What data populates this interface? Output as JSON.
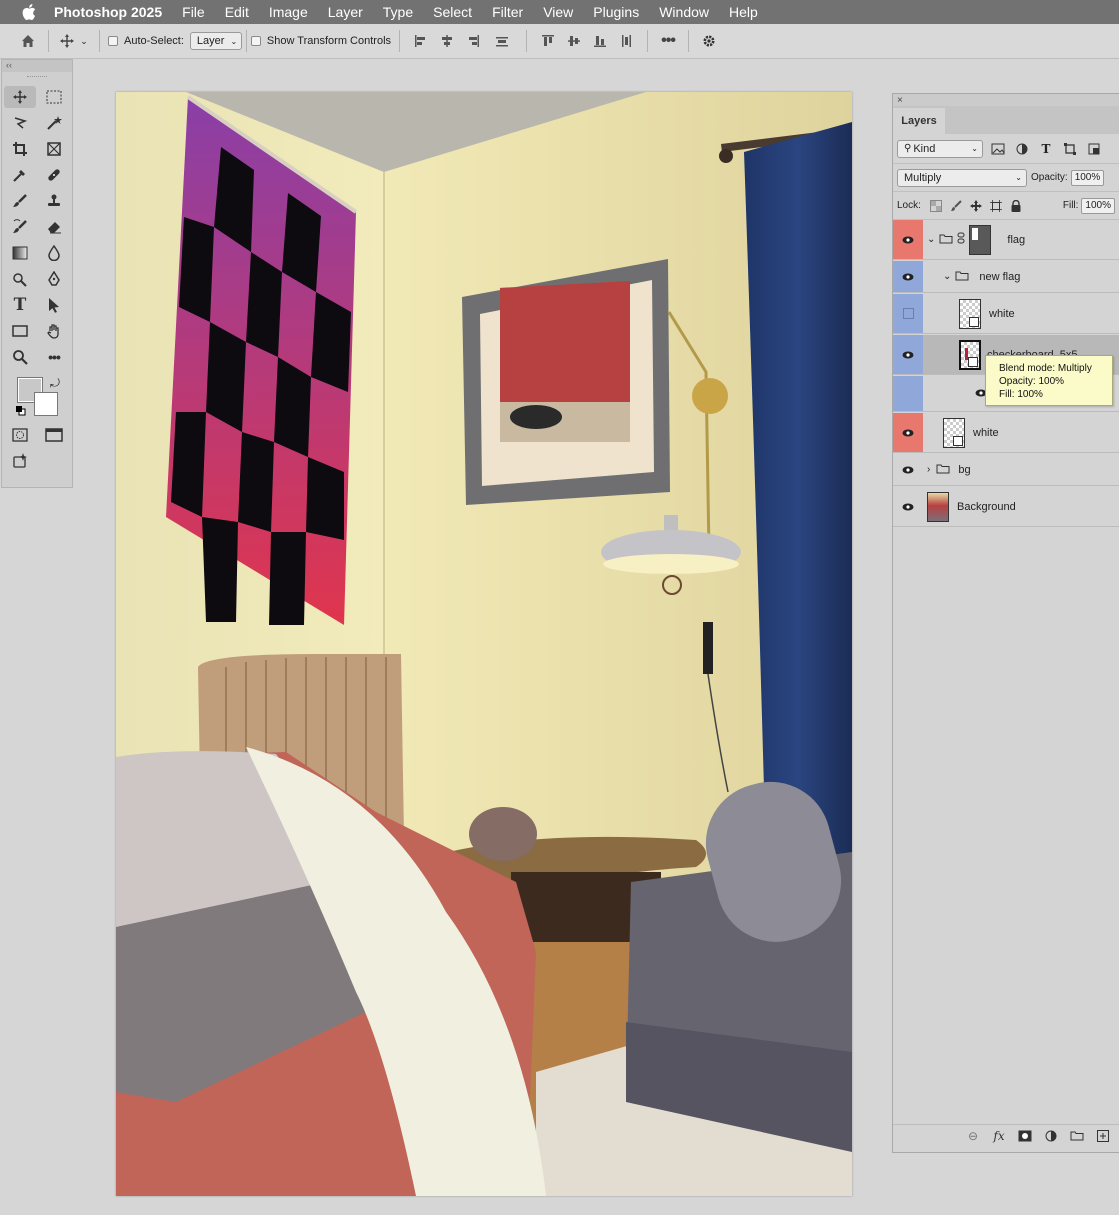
{
  "menubar": {
    "app_name": "Photoshop 2025",
    "items": [
      "File",
      "Edit",
      "Image",
      "Layer",
      "Type",
      "Select",
      "Filter",
      "View",
      "Plugins",
      "Window",
      "Help"
    ]
  },
  "options": {
    "auto_select_label": "Auto-Select:",
    "auto_select_value": "Layer",
    "show_transform_label": "Show Transform Controls"
  },
  "layers_panel": {
    "tab_label": "Layers",
    "filter_kind": "Kind",
    "blend_mode": "Multiply",
    "opacity_label": "Opacity:",
    "opacity_value": "100%",
    "lock_label": "Lock:",
    "fill_label": "Fill:",
    "fill_value": "100%",
    "layers": [
      {
        "name": "flag",
        "type": "group"
      },
      {
        "name": "new flag",
        "type": "group"
      },
      {
        "name": "white",
        "type": "smart-object"
      },
      {
        "name": "checkerboard_5x5",
        "type": "smart-object"
      },
      {
        "name": "white",
        "type": "smart-object"
      },
      {
        "name": "bg",
        "type": "group"
      },
      {
        "name": "Background",
        "type": "pixel"
      }
    ],
    "tooltip": {
      "line1": "Blend mode: Multiply",
      "line2": "Opacity: 100%",
      "line3": "Fill: 100%"
    }
  },
  "colors": {
    "menubar": "#727272",
    "label_red": "#e8776e",
    "label_blue": "#8fa7d9",
    "flag_purple": "#8a3fa7",
    "flag_red": "#e0354d",
    "curtain": "#1f3568"
  }
}
